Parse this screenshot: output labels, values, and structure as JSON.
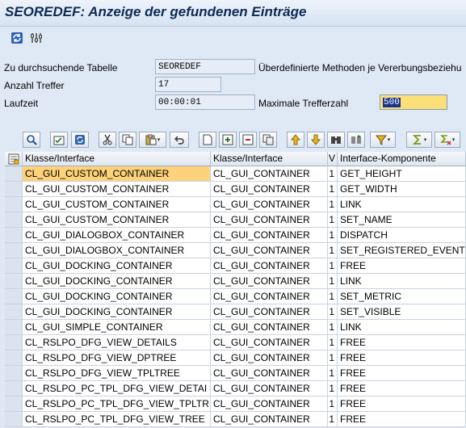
{
  "window": {
    "title": "SEOREDEF: Anzeige der gefundenen Einträge"
  },
  "app_toolbar": {
    "icons": [
      "refresh-icon",
      "settings-icon"
    ]
  },
  "selection": {
    "table_label": "Zu durchsuchende Tabelle",
    "table_value": "SEOREDEF",
    "table_desc": "Überdefinierte Methoden je Vererbungsbeziehu",
    "hits_label": "Anzahl Treffer",
    "hits_value": "17",
    "runtime_label": "Laufzeit",
    "runtime_value": "00:00:01",
    "maxhits_label": "Maximale Trefferzahl",
    "maxhits_value": "500"
  },
  "alv_toolbar": {
    "icons": [
      "details-icon",
      "check-icon",
      "refresh-icon",
      "cut-icon",
      "copy-icon",
      "paste-icon",
      "undo-icon",
      "new-row-icon",
      "insert-row-icon",
      "delete-row-icon",
      "copy-row-icon",
      "sort-asc-icon",
      "sort-desc-icon",
      "find-icon",
      "find-next-icon",
      "filter-icon",
      "sum-icon",
      "subtotal-icon"
    ]
  },
  "grid": {
    "columns": [
      "Klasse/Interface",
      "Klasse/Interface",
      "V",
      "Interface-Komponente"
    ],
    "rows": [
      [
        "CL_GUI_CUSTOM_CONTAINER",
        "CL_GUI_CONTAINER",
        "1",
        "GET_HEIGHT"
      ],
      [
        "CL_GUI_CUSTOM_CONTAINER",
        "CL_GUI_CONTAINER",
        "1",
        "GET_WIDTH"
      ],
      [
        "CL_GUI_CUSTOM_CONTAINER",
        "CL_GUI_CONTAINER",
        "1",
        "LINK"
      ],
      [
        "CL_GUI_CUSTOM_CONTAINER",
        "CL_GUI_CONTAINER",
        "1",
        "SET_NAME"
      ],
      [
        "CL_GUI_DIALOGBOX_CONTAINER",
        "CL_GUI_CONTAINER",
        "1",
        "DISPATCH"
      ],
      [
        "CL_GUI_DIALOGBOX_CONTAINER",
        "CL_GUI_CONTAINER",
        "1",
        "SET_REGISTERED_EVENTS"
      ],
      [
        "CL_GUI_DOCKING_CONTAINER",
        "CL_GUI_CONTAINER",
        "1",
        "FREE"
      ],
      [
        "CL_GUI_DOCKING_CONTAINER",
        "CL_GUI_CONTAINER",
        "1",
        "LINK"
      ],
      [
        "CL_GUI_DOCKING_CONTAINER",
        "CL_GUI_CONTAINER",
        "1",
        "SET_METRIC"
      ],
      [
        "CL_GUI_DOCKING_CONTAINER",
        "CL_GUI_CONTAINER",
        "1",
        "SET_VISIBLE"
      ],
      [
        "CL_GUI_SIMPLE_CONTAINER",
        "CL_GUI_CONTAINER",
        "1",
        "LINK"
      ],
      [
        "CL_RSLPO_DFG_VIEW_DETAILS",
        "CL_GUI_CONTAINER",
        "1",
        "FREE"
      ],
      [
        "CL_RSLPO_DFG_VIEW_DPTREE",
        "CL_GUI_CONTAINER",
        "1",
        "FREE"
      ],
      [
        "CL_RSLPO_DFG_VIEW_TPLTREE",
        "CL_GUI_CONTAINER",
        "1",
        "FREE"
      ],
      [
        "CL_RSLPO_PC_TPL_DFG_VIEW_DETAI",
        "CL_GUI_CONTAINER",
        "1",
        "FREE"
      ],
      [
        "CL_RSLPO_PC_TPL_DFG_VIEW_TPLTR",
        "CL_GUI_CONTAINER",
        "1",
        "FREE"
      ],
      [
        "CL_RSLPO_PC_TPL_DFG_VIEW_TREE",
        "CL_GUI_CONTAINER",
        "1",
        "FREE"
      ]
    ]
  }
}
